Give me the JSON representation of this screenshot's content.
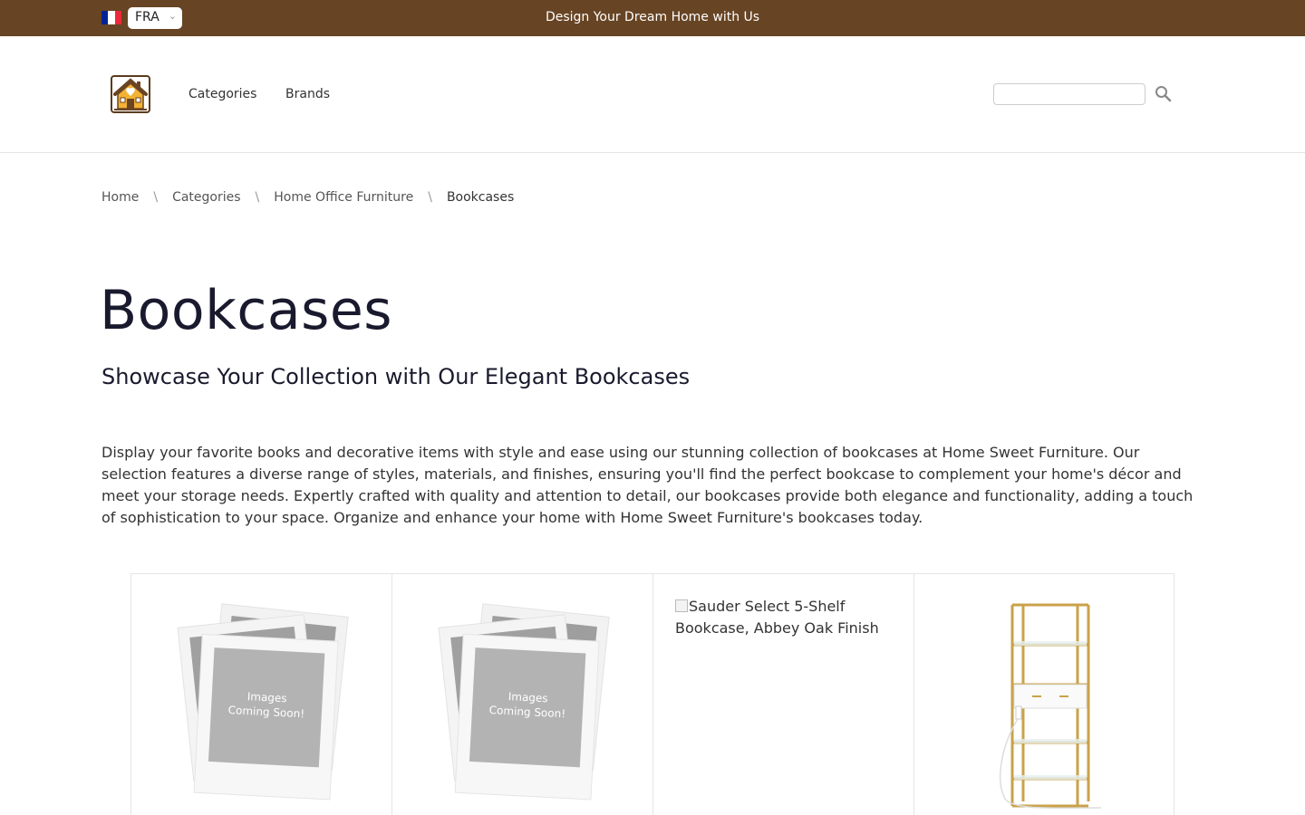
{
  "topbar": {
    "flag_colors": [
      "#002395",
      "#ffffff",
      "#ed2939"
    ],
    "language": "FRA",
    "banner_text": "Design Your Dream Home with Us",
    "background": "#674423"
  },
  "header": {
    "logo_icon": "house-heart-icon",
    "nav": [
      {
        "label": "Categories"
      },
      {
        "label": "Brands"
      }
    ],
    "search": {
      "placeholder": "",
      "icon": "search-icon"
    }
  },
  "breadcrumb": [
    "Home",
    "Categories",
    "Home Office Furniture",
    "Bookcases"
  ],
  "page": {
    "title": "Bookcases",
    "subtitle": "Showcase Your Collection with Our Elegant Bookcases",
    "description": "Display your favorite books and decorative items with style and ease using our stunning collection of bookcases at Home Sweet Furniture. Our selection features a diverse range of styles, materials, and finishes, ensuring you'll find the perfect bookcase to complement your home's décor and meet your storage needs. Expertly crafted with quality and attention to detail, our bookcases provide both elegance and functionality, adding a touch of sophistication to your space. Organize and enhance your home with Home Sweet Furniture's bookcases today."
  },
  "products": [
    {
      "image": "placeholder",
      "placeholder_line1": "Images",
      "placeholder_line2": "Coming Soon!"
    },
    {
      "image": "placeholder",
      "placeholder_line1": "Images",
      "placeholder_line2": "Coming Soon!"
    },
    {
      "image": "broken",
      "alt": "Sauder Select 5-Shelf Bookcase, Abbey Oak Finish"
    },
    {
      "image": "gold-glass-etagere"
    }
  ]
}
